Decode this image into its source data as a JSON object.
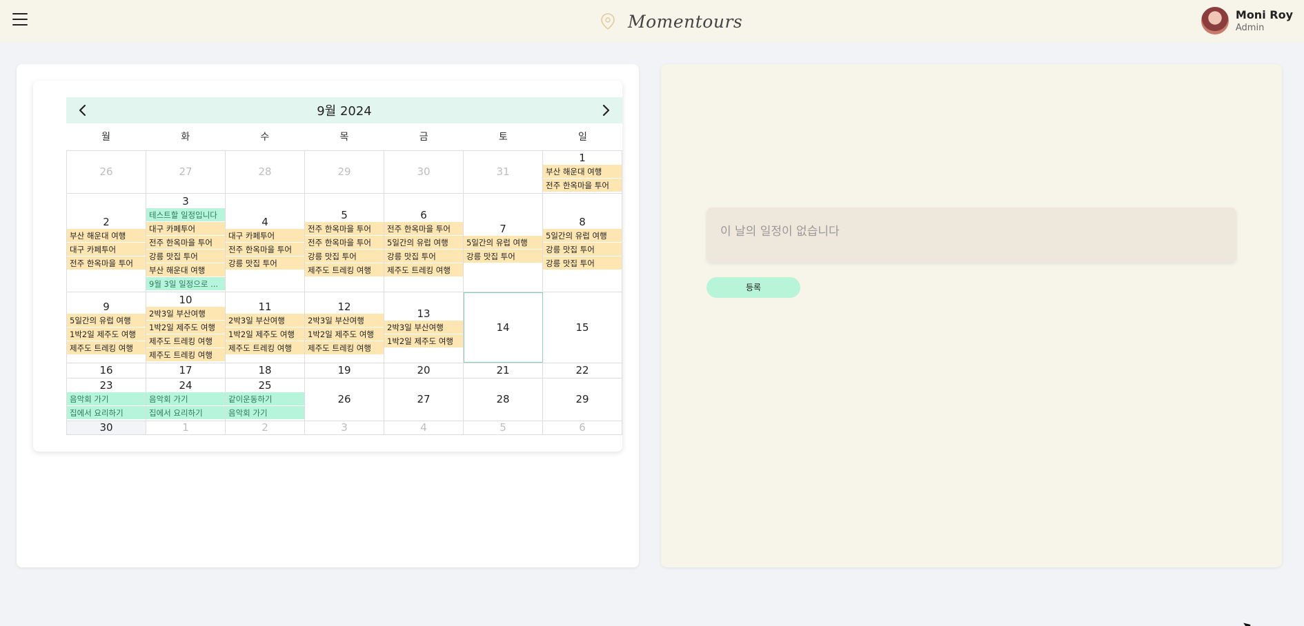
{
  "header": {
    "brand": "Momentours",
    "user_name": "Moni Roy",
    "user_role": "Admin"
  },
  "calendar": {
    "title": "9월 2024",
    "weekdays": [
      "월",
      "화",
      "수",
      "목",
      "금",
      "토",
      "일"
    ],
    "weeks": [
      {
        "h": 62,
        "days": [
          {
            "d": "26",
            "dim": true,
            "ev": []
          },
          {
            "d": "27",
            "dim": true,
            "ev": []
          },
          {
            "d": "28",
            "dim": true,
            "ev": []
          },
          {
            "d": "29",
            "dim": true,
            "ev": []
          },
          {
            "d": "30",
            "dim": true,
            "ev": []
          },
          {
            "d": "31",
            "dim": true,
            "ev": []
          },
          {
            "d": "1",
            "ev": [
              {
                "t": "부산 해운대 여행",
                "c": "y"
              },
              {
                "t": "전주 한옥마을 투어",
                "c": "y"
              }
            ]
          }
        ]
      },
      {
        "h": 143,
        "days": [
          {
            "d": "2",
            "ev": [
              {
                "t": "부산 해운대 여행",
                "c": "y"
              },
              {
                "t": "대구 카페투어",
                "c": "y"
              },
              {
                "t": "전주 한옥마을 투어",
                "c": "y"
              }
            ]
          },
          {
            "d": "3",
            "ev": [
              {
                "t": "테스트할 일정입니다",
                "c": "g"
              },
              {
                "t": "대구 카페투어",
                "c": "y"
              },
              {
                "t": "전주 한옥마을 투어",
                "c": "y"
              },
              {
                "t": "강릉 맛집 투어",
                "c": "y"
              },
              {
                "t": "부산 해운대 여행",
                "c": "y"
              },
              {
                "t": "9월 3일 일정으로 ...",
                "c": "g"
              }
            ]
          },
          {
            "d": "4",
            "ev": [
              {
                "t": "대구 카페투어",
                "c": "y"
              },
              {
                "t": "전주 한옥마을 투어",
                "c": "y"
              },
              {
                "t": "강릉 맛집 투어",
                "c": "y"
              }
            ]
          },
          {
            "d": "5",
            "ev": [
              {
                "t": "전주 한옥마을 투어",
                "c": "y"
              },
              {
                "t": "전주 한옥마을 투어",
                "c": "y"
              },
              {
                "t": "강릉 맛집 투어",
                "c": "y"
              },
              {
                "t": "제주도 트레킹 여행",
                "c": "y"
              }
            ]
          },
          {
            "d": "6",
            "ev": [
              {
                "t": "전주 한옥마을 투어",
                "c": "y"
              },
              {
                "t": "5일간의 유럽 여행",
                "c": "y"
              },
              {
                "t": "강릉 맛집 투어",
                "c": "y"
              },
              {
                "t": "제주도 트레킹 여행",
                "c": "y"
              }
            ]
          },
          {
            "d": "7",
            "ev": [
              {
                "t": "5일간의 유럽 여행",
                "c": "y"
              },
              {
                "t": "강릉 맛집 투어",
                "c": "y"
              }
            ]
          },
          {
            "d": "8",
            "ev": [
              {
                "t": "5일간의 유럽 여행",
                "c": "y"
              },
              {
                "t": "강릉 맛집 투어",
                "c": "y"
              },
              {
                "t": "강릉 맛집 투어",
                "c": "y"
              }
            ]
          }
        ]
      },
      {
        "h": 103,
        "days": [
          {
            "d": "9",
            "ev": [
              {
                "t": "5일간의 유럽 여행",
                "c": "y"
              },
              {
                "t": "1박2일 제주도 여행",
                "c": "y"
              },
              {
                "t": "제주도 트레킹 여행",
                "c": "y"
              }
            ]
          },
          {
            "d": "10",
            "ev": [
              {
                "t": "2박3일 부산여행",
                "c": "y"
              },
              {
                "t": "1박2일 제주도 여행",
                "c": "y"
              },
              {
                "t": "제주도 트레킹 여행",
                "c": "y"
              },
              {
                "t": "제주도 트레킹 여행",
                "c": "y"
              }
            ]
          },
          {
            "d": "11",
            "ev": [
              {
                "t": "2박3일 부산여행",
                "c": "y"
              },
              {
                "t": "1박2일 제주도 여행",
                "c": "y"
              },
              {
                "t": "제주도 트레킹 여행",
                "c": "y"
              }
            ]
          },
          {
            "d": "12",
            "ev": [
              {
                "t": "2박3일 부산여행",
                "c": "y"
              },
              {
                "t": "1박2일 제주도 여행",
                "c": "y"
              },
              {
                "t": "제주도 트레킹 여행",
                "c": "y"
              }
            ]
          },
          {
            "d": "13",
            "ev": [
              {
                "t": "2박3일 부산여행",
                "c": "y"
              },
              {
                "t": "1박2일 제주도 여행",
                "c": "y"
              }
            ]
          },
          {
            "d": "14",
            "today": true,
            "ev": []
          },
          {
            "d": "15",
            "ev": []
          }
        ]
      },
      {
        "h": 22,
        "days": [
          {
            "d": "16",
            "ev": []
          },
          {
            "d": "17",
            "ev": []
          },
          {
            "d": "18",
            "ev": []
          },
          {
            "d": "19",
            "ev": []
          },
          {
            "d": "20",
            "ev": []
          },
          {
            "d": "21",
            "ev": []
          },
          {
            "d": "22",
            "ev": []
          }
        ]
      },
      {
        "h": 62,
        "days": [
          {
            "d": "23",
            "ev": [
              {
                "t": "음악회 가기",
                "c": "g"
              },
              {
                "t": "집에서 요리하기",
                "c": "g"
              }
            ]
          },
          {
            "d": "24",
            "ev": [
              {
                "t": "음악회 가기",
                "c": "g"
              },
              {
                "t": "집에서 요리하기",
                "c": "g"
              }
            ]
          },
          {
            "d": "25",
            "ev": [
              {
                "t": "같이운동하기",
                "c": "g"
              },
              {
                "t": "음악회 가기",
                "c": "g"
              }
            ]
          },
          {
            "d": "26",
            "ev": []
          },
          {
            "d": "27",
            "ev": []
          },
          {
            "d": "28",
            "ev": []
          },
          {
            "d": "29",
            "ev": []
          }
        ]
      },
      {
        "h": 20,
        "days": [
          {
            "d": "30",
            "hl": true,
            "ev": []
          },
          {
            "d": "1",
            "dim": true,
            "ev": []
          },
          {
            "d": "2",
            "dim": true,
            "ev": []
          },
          {
            "d": "3",
            "dim": true,
            "ev": []
          },
          {
            "d": "4",
            "dim": true,
            "ev": []
          },
          {
            "d": "5",
            "dim": true,
            "ev": []
          },
          {
            "d": "6",
            "dim": true,
            "ev": []
          }
        ]
      }
    ]
  },
  "detail": {
    "empty_message": "이 날의 일정이 없습니다",
    "register_label": "등록"
  },
  "colors": {
    "event_yellow": "#fde6b2",
    "event_green": "#b6f5dc",
    "header_bg": "#f7f5ea",
    "calendar_head": "#e2f5ee"
  }
}
